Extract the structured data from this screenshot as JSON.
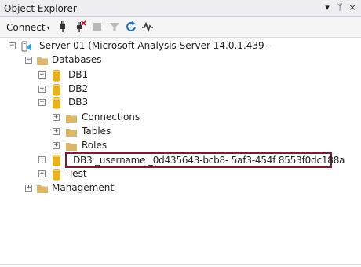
{
  "panel": {
    "title": "Object Explorer",
    "pin_glyph": "▾",
    "pin2_glyph": "ᛘ",
    "close_glyph": "×"
  },
  "toolbar": {
    "connect_label": "Connect",
    "connect_caret": "▾",
    "icons": [
      "connect-plug-icon",
      "disconnect-plug-icon",
      "stop-icon",
      "filter-icon",
      "refresh-icon",
      "activity-monitor-icon"
    ]
  },
  "tree": {
    "server": {
      "label": "Server 01 (Microsoft Analysis Server 14.0.1.439 -"
    },
    "databases": {
      "label": "Databases"
    },
    "db1": {
      "label": "DB1"
    },
    "db2": {
      "label": "DB2"
    },
    "db3": {
      "label": "DB3"
    },
    "connections": {
      "label": "Connections"
    },
    "tables": {
      "label": "Tables"
    },
    "roles": {
      "label": "Roles"
    },
    "rename_value": "DB3 _username _0d435643-bcb8- 5af3-454f 8553f0dc188a",
    "test": {
      "label": "Test"
    },
    "management": {
      "label": "Management"
    }
  },
  "expander_glyphs": {
    "collapsed": "+",
    "expanded": "−"
  },
  "colors": {
    "folder": "#dcb66b",
    "db_cylinder": "#e8b21e",
    "rename_border": "#7a1f2c",
    "refresh": "#1e6fc8"
  }
}
